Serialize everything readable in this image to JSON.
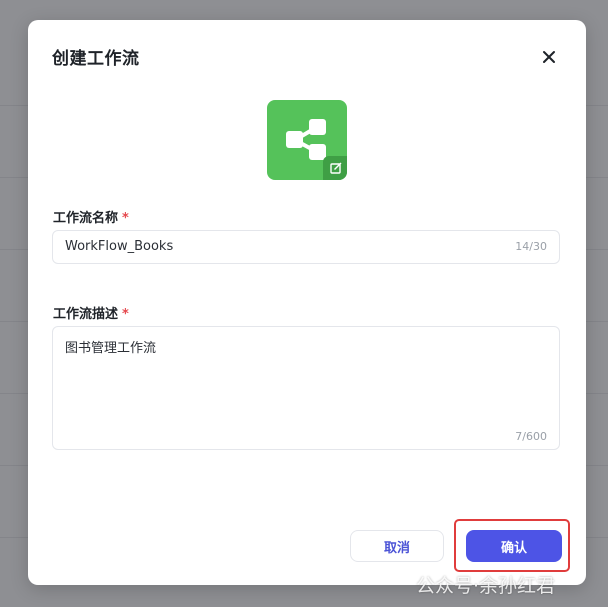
{
  "dialog": {
    "title": "创建工作流",
    "close_icon": "close-icon",
    "app_icon": {
      "icon": "workflow-nodes-icon",
      "edit_icon": "edit-icon",
      "color": "#55c25a"
    }
  },
  "fields": {
    "name": {
      "label": "工作流名称",
      "required_mark": "*",
      "value": "WorkFlow_Books",
      "counter": "14/30"
    },
    "description": {
      "label": "工作流描述",
      "required_mark": "*",
      "value": "图书管理工作流",
      "counter": "7/600"
    }
  },
  "footer": {
    "cancel_label": "取消",
    "confirm_label": "确认"
  },
  "colors": {
    "accent": "#4d54e6",
    "required": "#e5484d",
    "highlight": "#e03c3c"
  },
  "watermark": "公众号·余孙红君"
}
